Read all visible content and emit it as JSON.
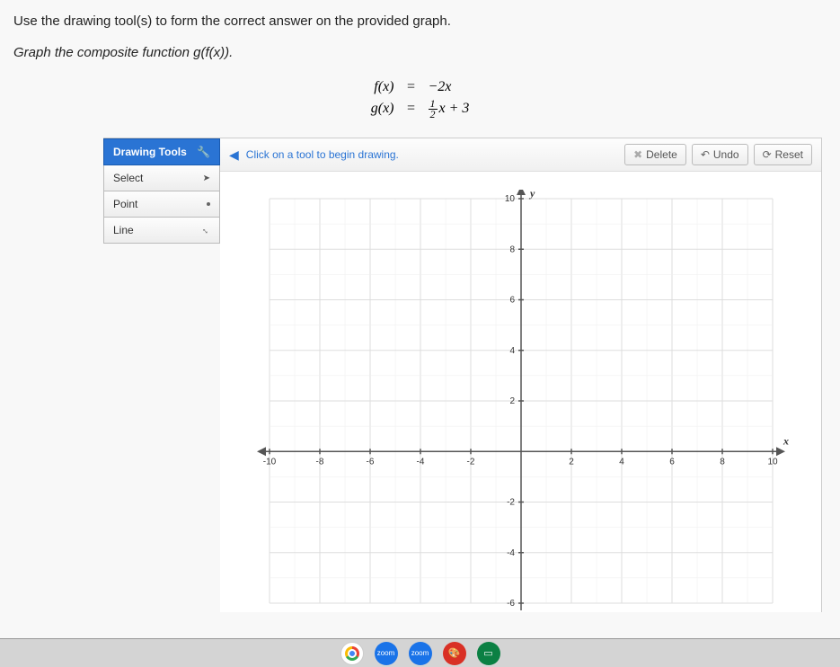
{
  "instruction": "Use the drawing tool(s) to form the correct answer on the provided graph.",
  "task": "Graph the composite function g(f(x)).",
  "equations": {
    "f": {
      "lhs": "f(x)",
      "rhs": "−2x"
    },
    "g": {
      "lhs": "g(x)",
      "rhs_num": "1",
      "rhs_den": "2",
      "rhs_rest": "x + 3"
    }
  },
  "sidebar": {
    "header": "Drawing Tools",
    "tools": [
      "Select",
      "Point",
      "Line"
    ]
  },
  "toolbar": {
    "prompt": "Click on a tool to begin drawing.",
    "delete": "Delete",
    "undo": "Undo",
    "reset": "Reset"
  },
  "chart_data": {
    "type": "scatter",
    "title": "",
    "xlabel": "x",
    "ylabel": "y",
    "xlim": [
      -10,
      10
    ],
    "ylim": [
      -6,
      10
    ],
    "xticks": [
      -10,
      -8,
      -6,
      -4,
      -2,
      2,
      4,
      6,
      8,
      10
    ],
    "yticks": [
      -6,
      -4,
      -2,
      2,
      4,
      6,
      8,
      10
    ],
    "series": []
  },
  "taskbar": {
    "zoom1": "zoom",
    "zoom2": "zoom"
  }
}
